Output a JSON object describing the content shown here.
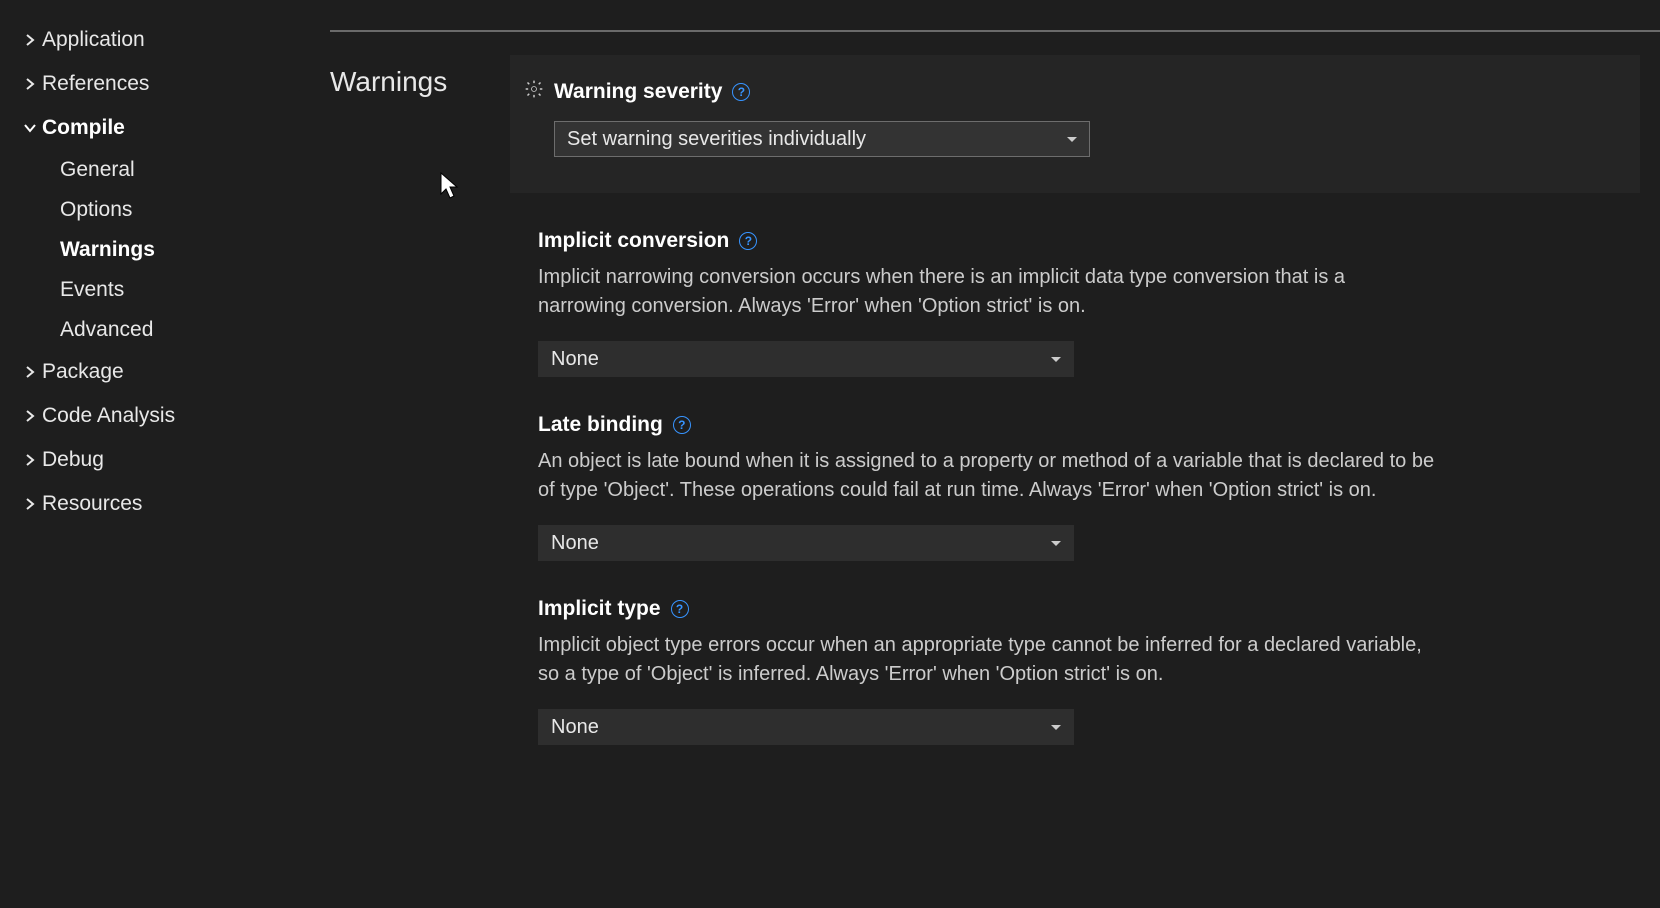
{
  "sidebar": {
    "items": [
      {
        "label": "Application",
        "expanded": false,
        "bold": false,
        "children": []
      },
      {
        "label": "References",
        "expanded": false,
        "bold": false,
        "children": []
      },
      {
        "label": "Compile",
        "expanded": true,
        "bold": true,
        "children": [
          {
            "label": "General",
            "bold": false
          },
          {
            "label": "Options",
            "bold": false
          },
          {
            "label": "Warnings",
            "bold": true
          },
          {
            "label": "Events",
            "bold": false
          },
          {
            "label": "Advanced",
            "bold": false
          }
        ]
      },
      {
        "label": "Package",
        "expanded": false,
        "bold": false,
        "children": []
      },
      {
        "label": "Code Analysis",
        "expanded": false,
        "bold": false,
        "children": []
      },
      {
        "label": "Debug",
        "expanded": false,
        "bold": false,
        "children": []
      },
      {
        "label": "Resources",
        "expanded": false,
        "bold": false,
        "children": []
      }
    ]
  },
  "section_title": "Warnings",
  "warning_severity": {
    "label": "Warning severity",
    "value": "Set warning severities individually"
  },
  "settings": [
    {
      "label": "Implicit conversion",
      "desc": "Implicit narrowing conversion occurs when there is an implicit data type conversion that is a narrowing conversion. Always 'Error' when 'Option strict' is on.",
      "value": "None"
    },
    {
      "label": "Late binding",
      "desc": "An object is late bound when it is assigned to a property or method of a variable that is declared to be of type 'Object'. These operations could fail at run time. Always 'Error' when 'Option strict' is on.",
      "value": "None"
    },
    {
      "label": "Implicit type",
      "desc": "Implicit object type errors occur when an appropriate type cannot be inferred for a declared variable, so a type of 'Object' is inferred. Always 'Error' when 'Option strict' is on.",
      "value": "None"
    }
  ]
}
